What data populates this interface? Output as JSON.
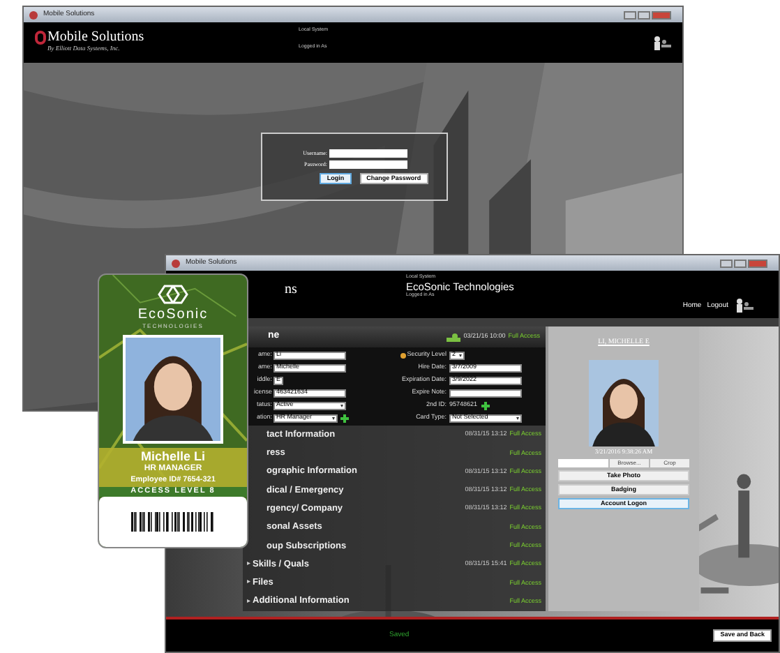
{
  "login_window": {
    "title": "Mobile Solutions",
    "header": {
      "logo_name": "Mobile Solutions",
      "logo_tagline": "By Elliott Data Systems, Inc.",
      "system_label": "Local System",
      "logged_in_label": "Logged in As"
    },
    "login": {
      "fields": [
        {
          "label": "Username:"
        },
        {
          "label": "Password:"
        }
      ],
      "buttons": [
        {
          "label": "Login",
          "focused": true
        },
        {
          "label": "Change Password",
          "focused": false
        }
      ]
    }
  },
  "record_window": {
    "title": "Mobile Solutions",
    "header": {
      "logo_fragment": "ns",
      "system_label": "Local System",
      "organization": "EcoSonic Technologies",
      "logged_in_label": "Logged in As",
      "nav": [
        "Home",
        "Logout"
      ]
    },
    "panel": {
      "title": "ne",
      "timestamp": "03/21/16 10:00",
      "access": "Full Access",
      "fields_left": [
        {
          "kind": "text",
          "label": "ame:",
          "value": "Li"
        },
        {
          "kind": "text",
          "label": "ame:",
          "value": "Michelle"
        },
        {
          "kind": "short",
          "label": "iddle:",
          "value": "E"
        },
        {
          "kind": "text",
          "label": "icense",
          "value": "463421634"
        },
        {
          "kind": "select",
          "label": "tatus:",
          "value": "Active"
        },
        {
          "kind": "select_add",
          "label": "ation:",
          "value": "HR Manager"
        }
      ],
      "fields_right": [
        {
          "kind": "select_short",
          "label": "Security Level",
          "value": "2"
        },
        {
          "kind": "text",
          "label": "Hire Date:",
          "value": "3/7/2009"
        },
        {
          "kind": "text",
          "label": "Expiration Date:",
          "value": "3/9/2022"
        },
        {
          "kind": "text",
          "label": "Expire Note:"
        },
        {
          "kind": "plain_add",
          "label": "2nd ID:",
          "value": "95748621"
        },
        {
          "kind": "select",
          "label": "Card Type:",
          "value": "Not Selected"
        }
      ],
      "sections": [
        {
          "label": "tact Information",
          "timestamp": "08/31/15 13:12",
          "access": "Full Access"
        },
        {
          "label": "ress",
          "access": "Full Access"
        },
        {
          "label": "ographic Information",
          "timestamp": "08/31/15 13:12",
          "access": "Full Access"
        },
        {
          "label": "dical / Emergency",
          "timestamp": "08/31/15 13:12",
          "access": "Full Access"
        },
        {
          "label": "rgency/ Company",
          "timestamp": "08/31/15 13:12",
          "access": "Full Access"
        },
        {
          "label": "sonal Assets",
          "access": "Full Access"
        },
        {
          "label": "oup Subscriptions",
          "access": "Full Access"
        },
        {
          "marker": "▸",
          "label": "Skills / Quals",
          "timestamp": "08/31/15 15:41",
          "access": "Full Access"
        },
        {
          "marker": "▸",
          "label": "Files",
          "access": "Full Access"
        },
        {
          "marker": "▸",
          "label": "Additional Information",
          "access": "Full Access"
        }
      ]
    },
    "photo_panel": {
      "name": "LI, MICHELLE E",
      "captured": "3/21/2016 9:38:26 AM",
      "browse": "Browse...",
      "crop": "Crop",
      "buttons": [
        {
          "label": "Take Photo",
          "focused": false
        },
        {
          "label": "Badging",
          "focused": false
        },
        {
          "label": "Account Logon",
          "focused": true
        }
      ]
    },
    "footer": {
      "status": "Saved",
      "button": "Save and Back"
    }
  },
  "id_card": {
    "company": "EcoSonic",
    "company_sub": "TECHNOLOGIES",
    "name": "Michelle Li",
    "job_title": "HR MANAGER",
    "employee_id": "Employee ID# 7654-321",
    "access": "ACCESS LEVEL 8"
  }
}
